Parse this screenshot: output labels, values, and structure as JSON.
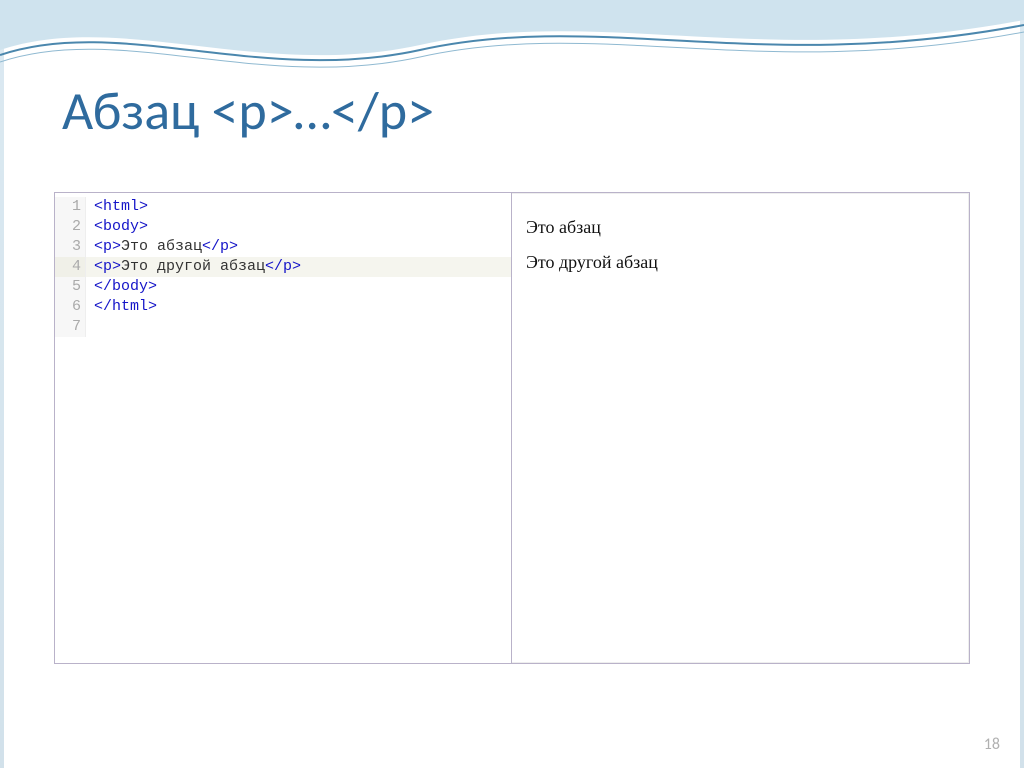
{
  "title": "Абзац  <p>…</p>",
  "code": {
    "lines": [
      {
        "n": "1",
        "indent": "",
        "open": "<html>",
        "text": "",
        "close": ""
      },
      {
        "n": "2",
        "indent": "",
        "open": "<body>",
        "text": "",
        "close": ""
      },
      {
        "n": "3",
        "indent": "  ",
        "open": "<p>",
        "text": "Это абзац",
        "close": "</p>"
      },
      {
        "n": "4",
        "indent": "  ",
        "open": "<p>",
        "text": "Это другой абзац",
        "close": "</p>",
        "highlight": true
      },
      {
        "n": "5",
        "indent": "",
        "open": "</body>",
        "text": "",
        "close": ""
      },
      {
        "n": "6",
        "indent": "",
        "open": "</html>",
        "text": "",
        "close": ""
      },
      {
        "n": "7",
        "indent": "",
        "open": "",
        "text": "",
        "close": ""
      }
    ]
  },
  "preview": {
    "para1": "Это абзац",
    "para2": "Это другой абзац"
  },
  "page_number": "18"
}
